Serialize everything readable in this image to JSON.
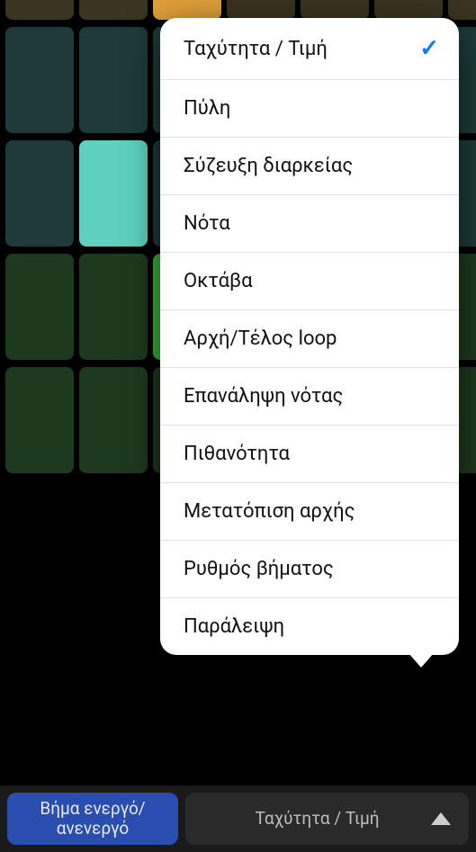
{
  "grid": {
    "rows": [
      {
        "cells": [
          {
            "bg": "#3a3420"
          },
          {
            "bg": "#3a3420"
          },
          {
            "bg": "#e0a03a"
          },
          {
            "bg": "#3a3420"
          },
          {
            "bg": "#3a3420"
          },
          {
            "bg": "#3a3420"
          },
          {
            "bg": "#3a3420"
          }
        ]
      },
      {
        "cells": [
          {
            "bg": "#1e3a3a"
          },
          {
            "bg": "#1e3a3a"
          },
          {
            "bg": "#1e3a3a"
          },
          {
            "bg": "#1e3a3a"
          },
          {
            "bg": "#1e3a3a"
          },
          {
            "bg": "#1e3a3a"
          },
          {
            "bg": "#1e3a3a"
          }
        ]
      },
      {
        "cells": [
          {
            "bg": "#1e3a3a"
          },
          {
            "bg": "#5ed0c0"
          },
          {
            "bg": "#1e3a3a"
          },
          {
            "bg": "#1e3a3a"
          },
          {
            "bg": "#1e3a3a"
          },
          {
            "bg": "#1e3a3a"
          },
          {
            "bg": "#1e3a3a"
          }
        ]
      },
      {
        "cells": [
          {
            "bg": "#1e3a1e"
          },
          {
            "bg": "#1e3a1e"
          },
          {
            "bg": "#3ab03a"
          },
          {
            "bg": "#1e3a1e"
          },
          {
            "bg": "#1e3a1e"
          },
          {
            "bg": "#1e3a1e"
          },
          {
            "bg": "#1e3a1e"
          }
        ]
      },
      {
        "cells": [
          {
            "bg": "#1e3a1e"
          },
          {
            "bg": "#1e3a1e"
          },
          {
            "bg": "#1e3a1e"
          },
          {
            "bg": "#1e3a1e"
          },
          {
            "bg": "#1e3a1e"
          },
          {
            "bg": "#1e3a1e"
          },
          {
            "bg": "#1e3a1e"
          }
        ]
      }
    ]
  },
  "menu": {
    "items": [
      {
        "label": "Ταχύτητα / Τιμή",
        "selected": true
      },
      {
        "label": "Πύλη",
        "selected": false
      },
      {
        "label": "Σύζευξη διαρκείας",
        "selected": false
      },
      {
        "label": "Νότα",
        "selected": false
      },
      {
        "label": "Οκτάβα",
        "selected": false
      },
      {
        "label": "Αρχή/Τέλος loop",
        "selected": false
      },
      {
        "label": "Επανάληψη νότας",
        "selected": false
      },
      {
        "label": "Πιθανότητα",
        "selected": false
      },
      {
        "label": "Μετατόπιση αρχής",
        "selected": false
      },
      {
        "label": "Ρυθμός βήματος",
        "selected": false
      },
      {
        "label": "Παράλειψη",
        "selected": false
      }
    ]
  },
  "bottom": {
    "step_toggle_label": "Βήμα ενεργό/\nανενεργό",
    "mode_label": "Ταχύτητα / Τιμή"
  }
}
